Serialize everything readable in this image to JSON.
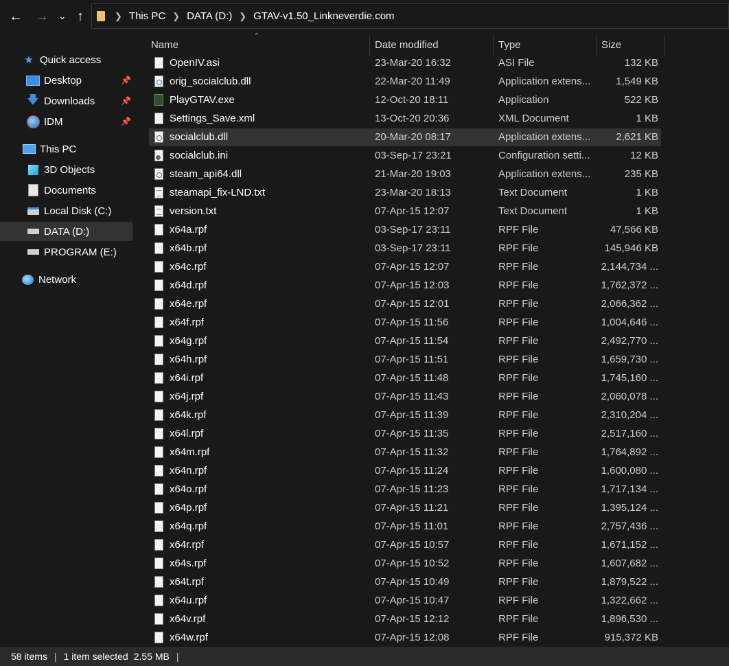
{
  "address": {
    "breadcrumbs": [
      "This PC",
      "DATA (D:)",
      "GTAV-v1.50_Linkneverdie.com"
    ]
  },
  "sidebar": {
    "items": [
      {
        "label": "Quick access",
        "icon": "star-icon",
        "pinned": false,
        "selected": false
      },
      {
        "label": "Desktop",
        "icon": "desktop-icon",
        "pinned": true,
        "selected": false
      },
      {
        "label": "Downloads",
        "icon": "download-icon",
        "pinned": true,
        "selected": false
      },
      {
        "label": "IDM",
        "icon": "idm-icon",
        "pinned": true,
        "selected": false
      },
      {
        "label": "This PC",
        "icon": "computer-icon",
        "pinned": false,
        "selected": false
      },
      {
        "label": "3D Objects",
        "icon": "cube-icon",
        "pinned": false,
        "selected": false
      },
      {
        "label": "Documents",
        "icon": "document-icon",
        "pinned": false,
        "selected": false
      },
      {
        "label": "Local Disk (C:)",
        "icon": "drive-icon",
        "pinned": false,
        "selected": false
      },
      {
        "label": "DATA (D:)",
        "icon": "drive-icon",
        "pinned": false,
        "selected": true
      },
      {
        "label": "PROGRAM (E:)",
        "icon": "drive-icon",
        "pinned": false,
        "selected": false
      },
      {
        "label": "Network",
        "icon": "network-icon",
        "pinned": false,
        "selected": false
      }
    ]
  },
  "columns": {
    "name": "Name",
    "date": "Date modified",
    "type": "Type",
    "size": "Size"
  },
  "files": [
    {
      "name": "OpenIV.asi",
      "date": "23-Mar-20 16:32",
      "type": "ASI File",
      "size": "132 KB",
      "icon": "file-icon",
      "selected": false
    },
    {
      "name": "orig_socialclub.dll",
      "date": "22-Mar-20 11:49",
      "type": "Application extens...",
      "size": "1,549 KB",
      "icon": "dll-icon",
      "selected": false
    },
    {
      "name": "PlayGTAV.exe",
      "date": "12-Oct-20 18:11",
      "type": "Application",
      "size": "522 KB",
      "icon": "exe-icon",
      "selected": false
    },
    {
      "name": "Settings_Save.xml",
      "date": "13-Oct-20 20:36",
      "type": "XML Document",
      "size": "1 KB",
      "icon": "file-icon",
      "selected": false
    },
    {
      "name": "socialclub.dll",
      "date": "20-Mar-20 08:17",
      "type": "Application extens...",
      "size": "2,621 KB",
      "icon": "dll-icon",
      "selected": true
    },
    {
      "name": "socialclub.ini",
      "date": "03-Sep-17 23:21",
      "type": "Configuration setti...",
      "size": "12 KB",
      "icon": "ini-icon",
      "selected": false
    },
    {
      "name": "steam_api64.dll",
      "date": "21-Mar-20 19:03",
      "type": "Application extens...",
      "size": "235 KB",
      "icon": "dll-icon",
      "selected": false
    },
    {
      "name": "steamapi_fix-LND.txt",
      "date": "23-Mar-20 18:13",
      "type": "Text Document",
      "size": "1 KB",
      "icon": "txt-icon",
      "selected": false
    },
    {
      "name": "version.txt",
      "date": "07-Apr-15 12:07",
      "type": "Text Document",
      "size": "1 KB",
      "icon": "txt-icon",
      "selected": false
    },
    {
      "name": "x64a.rpf",
      "date": "03-Sep-17 23:11",
      "type": "RPF File",
      "size": "47,566 KB",
      "icon": "file-icon",
      "selected": false
    },
    {
      "name": "x64b.rpf",
      "date": "03-Sep-17 23:11",
      "type": "RPF File",
      "size": "145,946 KB",
      "icon": "file-icon",
      "selected": false
    },
    {
      "name": "x64c.rpf",
      "date": "07-Apr-15 12:07",
      "type": "RPF File",
      "size": "2,144,734 ...",
      "icon": "file-icon",
      "selected": false
    },
    {
      "name": "x64d.rpf",
      "date": "07-Apr-15 12:03",
      "type": "RPF File",
      "size": "1,762,372 ...",
      "icon": "file-icon",
      "selected": false
    },
    {
      "name": "x64e.rpf",
      "date": "07-Apr-15 12:01",
      "type": "RPF File",
      "size": "2,066,362 ...",
      "icon": "file-icon",
      "selected": false
    },
    {
      "name": "x64f.rpf",
      "date": "07-Apr-15 11:56",
      "type": "RPF File",
      "size": "1,004,646 ...",
      "icon": "file-icon",
      "selected": false
    },
    {
      "name": "x64g.rpf",
      "date": "07-Apr-15 11:54",
      "type": "RPF File",
      "size": "2,492,770 ...",
      "icon": "file-icon",
      "selected": false
    },
    {
      "name": "x64h.rpf",
      "date": "07-Apr-15 11:51",
      "type": "RPF File",
      "size": "1,659,730 ...",
      "icon": "file-icon",
      "selected": false
    },
    {
      "name": "x64i.rpf",
      "date": "07-Apr-15 11:48",
      "type": "RPF File",
      "size": "1,745,160 ...",
      "icon": "file-icon",
      "selected": false
    },
    {
      "name": "x64j.rpf",
      "date": "07-Apr-15 11:43",
      "type": "RPF File",
      "size": "2,060,078 ...",
      "icon": "file-icon",
      "selected": false
    },
    {
      "name": "x64k.rpf",
      "date": "07-Apr-15 11:39",
      "type": "RPF File",
      "size": "2,310,204 ...",
      "icon": "file-icon",
      "selected": false
    },
    {
      "name": "x64l.rpf",
      "date": "07-Apr-15 11:35",
      "type": "RPF File",
      "size": "2,517,160 ...",
      "icon": "file-icon",
      "selected": false
    },
    {
      "name": "x64m.rpf",
      "date": "07-Apr-15 11:32",
      "type": "RPF File",
      "size": "1,764,892 ...",
      "icon": "file-icon",
      "selected": false
    },
    {
      "name": "x64n.rpf",
      "date": "07-Apr-15 11:24",
      "type": "RPF File",
      "size": "1,600,080 ...",
      "icon": "file-icon",
      "selected": false
    },
    {
      "name": "x64o.rpf",
      "date": "07-Apr-15 11:23",
      "type": "RPF File",
      "size": "1,717,134 ...",
      "icon": "file-icon",
      "selected": false
    },
    {
      "name": "x64p.rpf",
      "date": "07-Apr-15 11:21",
      "type": "RPF File",
      "size": "1,395,124 ...",
      "icon": "file-icon",
      "selected": false
    },
    {
      "name": "x64q.rpf",
      "date": "07-Apr-15 11:01",
      "type": "RPF File",
      "size": "2,757,436 ...",
      "icon": "file-icon",
      "selected": false
    },
    {
      "name": "x64r.rpf",
      "date": "07-Apr-15 10:57",
      "type": "RPF File",
      "size": "1,671,152 ...",
      "icon": "file-icon",
      "selected": false
    },
    {
      "name": "x64s.rpf",
      "date": "07-Apr-15 10:52",
      "type": "RPF File",
      "size": "1,607,682 ...",
      "icon": "file-icon",
      "selected": false
    },
    {
      "name": "x64t.rpf",
      "date": "07-Apr-15 10:49",
      "type": "RPF File",
      "size": "1,879,522 ...",
      "icon": "file-icon",
      "selected": false
    },
    {
      "name": "x64u.rpf",
      "date": "07-Apr-15 10:47",
      "type": "RPF File",
      "size": "1,322,662 ...",
      "icon": "file-icon",
      "selected": false
    },
    {
      "name": "x64v.rpf",
      "date": "07-Apr-15 12:12",
      "type": "RPF File",
      "size": "1,896,530 ...",
      "icon": "file-icon",
      "selected": false
    },
    {
      "name": "x64w.rpf",
      "date": "07-Apr-15 12:08",
      "type": "RPF File",
      "size": "915,372 KB",
      "icon": "file-icon",
      "selected": false
    }
  ],
  "status": {
    "item_count": "58 items",
    "selection": "1 item selected",
    "selection_size": "2.55 MB"
  },
  "colors": {
    "background": "#191919",
    "selected_row": "#333333",
    "status_bar": "#2b2b2b",
    "folder_yellow": "#e9c46a"
  }
}
